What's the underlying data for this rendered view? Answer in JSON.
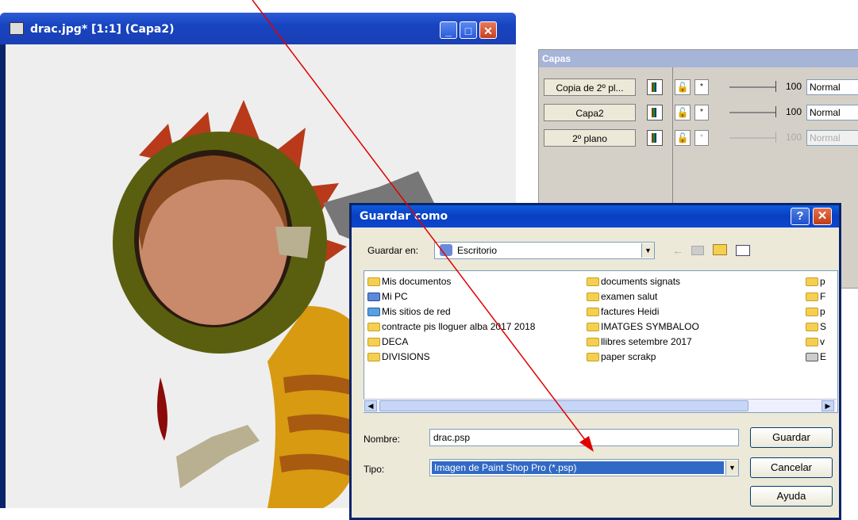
{
  "image_window": {
    "title": "drac.jpg* [1:1] (Capa2)",
    "buttons": {
      "minimize": "_",
      "maximize": "□",
      "close": "✕"
    }
  },
  "layers_panel": {
    "title": "Capas",
    "rows": [
      {
        "name": "Copia de 2º pl...",
        "opacity": "100",
        "blend": "Normal",
        "lock": "🔓",
        "mask": "*"
      },
      {
        "name": "Capa2",
        "opacity": "100",
        "blend": "Normal",
        "lock": "🔓",
        "mask": "*"
      },
      {
        "name": "2º plano",
        "opacity": "100",
        "blend": "Normal",
        "lock": "🔓",
        "mask": "*"
      }
    ]
  },
  "save_dialog": {
    "title": "Guardar como",
    "help": "?",
    "close": "✕",
    "save_in_label": "Guardar en:",
    "save_in_value": "Escritorio",
    "files_col1": [
      "Mis documentos",
      "Mi PC",
      "Mis sitios de red",
      "contracte pis lloguer alba 2017 2018",
      "DECA",
      "DIVISIONS"
    ],
    "files_col2": [
      "documents signats",
      "examen salut",
      "factures Heidi",
      "IMATGES SYMBALOO",
      "llibres setembre 2017",
      "paper scrakp"
    ],
    "files_col3": [
      "p",
      "F",
      "p",
      "S",
      "v",
      "E"
    ],
    "name_label": "Nombre:",
    "name_value": "drac.psp",
    "type_label": "Tipo:",
    "type_value": "Imagen de Paint Shop Pro (*.psp)",
    "buttons": {
      "save": "Guardar",
      "cancel": "Cancelar",
      "help": "Ayuda"
    }
  },
  "colors": {
    "title_blue": "#0a246a",
    "selection": "#316ac5",
    "arrow": "#e00000"
  }
}
